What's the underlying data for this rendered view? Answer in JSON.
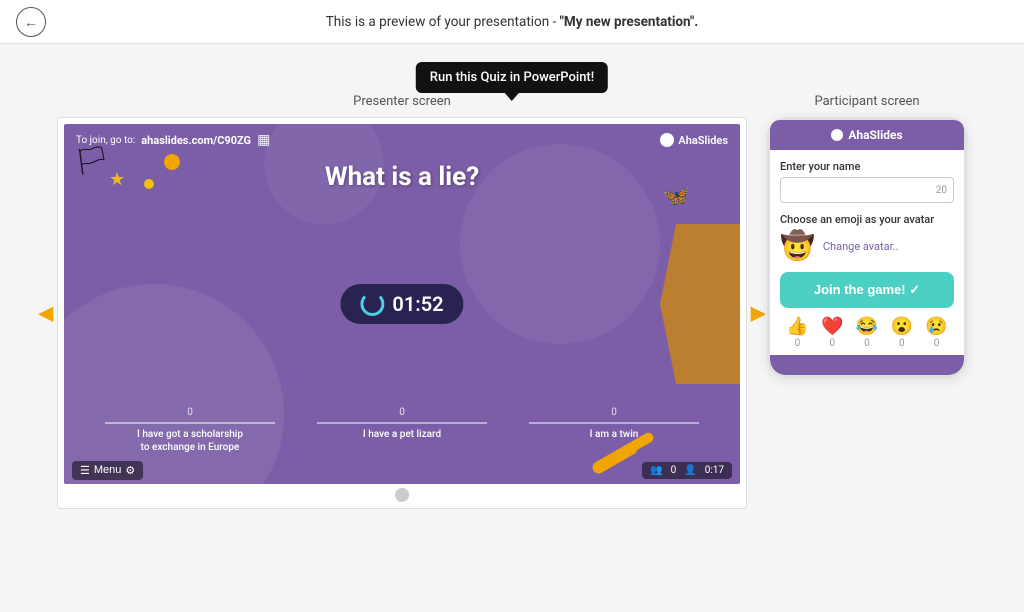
{
  "header": {
    "preview_text": "This is a preview of your presentation - ",
    "presentation_name": "\"My new presentation\".",
    "back_label": "←"
  },
  "tooltip": {
    "label": "Run this Quiz in PowerPoint!"
  },
  "presenter_section": {
    "label": "Presenter screen",
    "slide": {
      "join_text": "To join, go to:",
      "join_url": "ahaslides.com/C90ZG",
      "brand": "AhaSlides",
      "question": "What is a lie?",
      "timer": "01:52",
      "answers": [
        {
          "label": "I have got a scholarship\nto exchange in Europe",
          "count": "0"
        },
        {
          "label": "I have a pet lizard",
          "count": "0"
        },
        {
          "label": "I am a twin",
          "count": "0"
        }
      ],
      "menu_label": "Menu",
      "stats_players": "0",
      "stats_time": "0:17"
    }
  },
  "participant_section": {
    "label": "Participant screen",
    "phone": {
      "brand": "AhaSlides",
      "name_label": "Enter your name",
      "name_placeholder": "",
      "char_count": "20",
      "emoji_label": "Choose an emoji as your avatar",
      "avatar_emoji": "🤠",
      "change_avatar_label": "Change avatar..",
      "join_button": "Join the game! ✓",
      "reactions": [
        {
          "emoji": "👍",
          "count": "0"
        },
        {
          "emoji": "❤️",
          "count": "0"
        },
        {
          "emoji": "😂",
          "count": "0"
        },
        {
          "emoji": "😮",
          "count": "0"
        },
        {
          "emoji": "😢",
          "count": "0"
        }
      ]
    }
  }
}
